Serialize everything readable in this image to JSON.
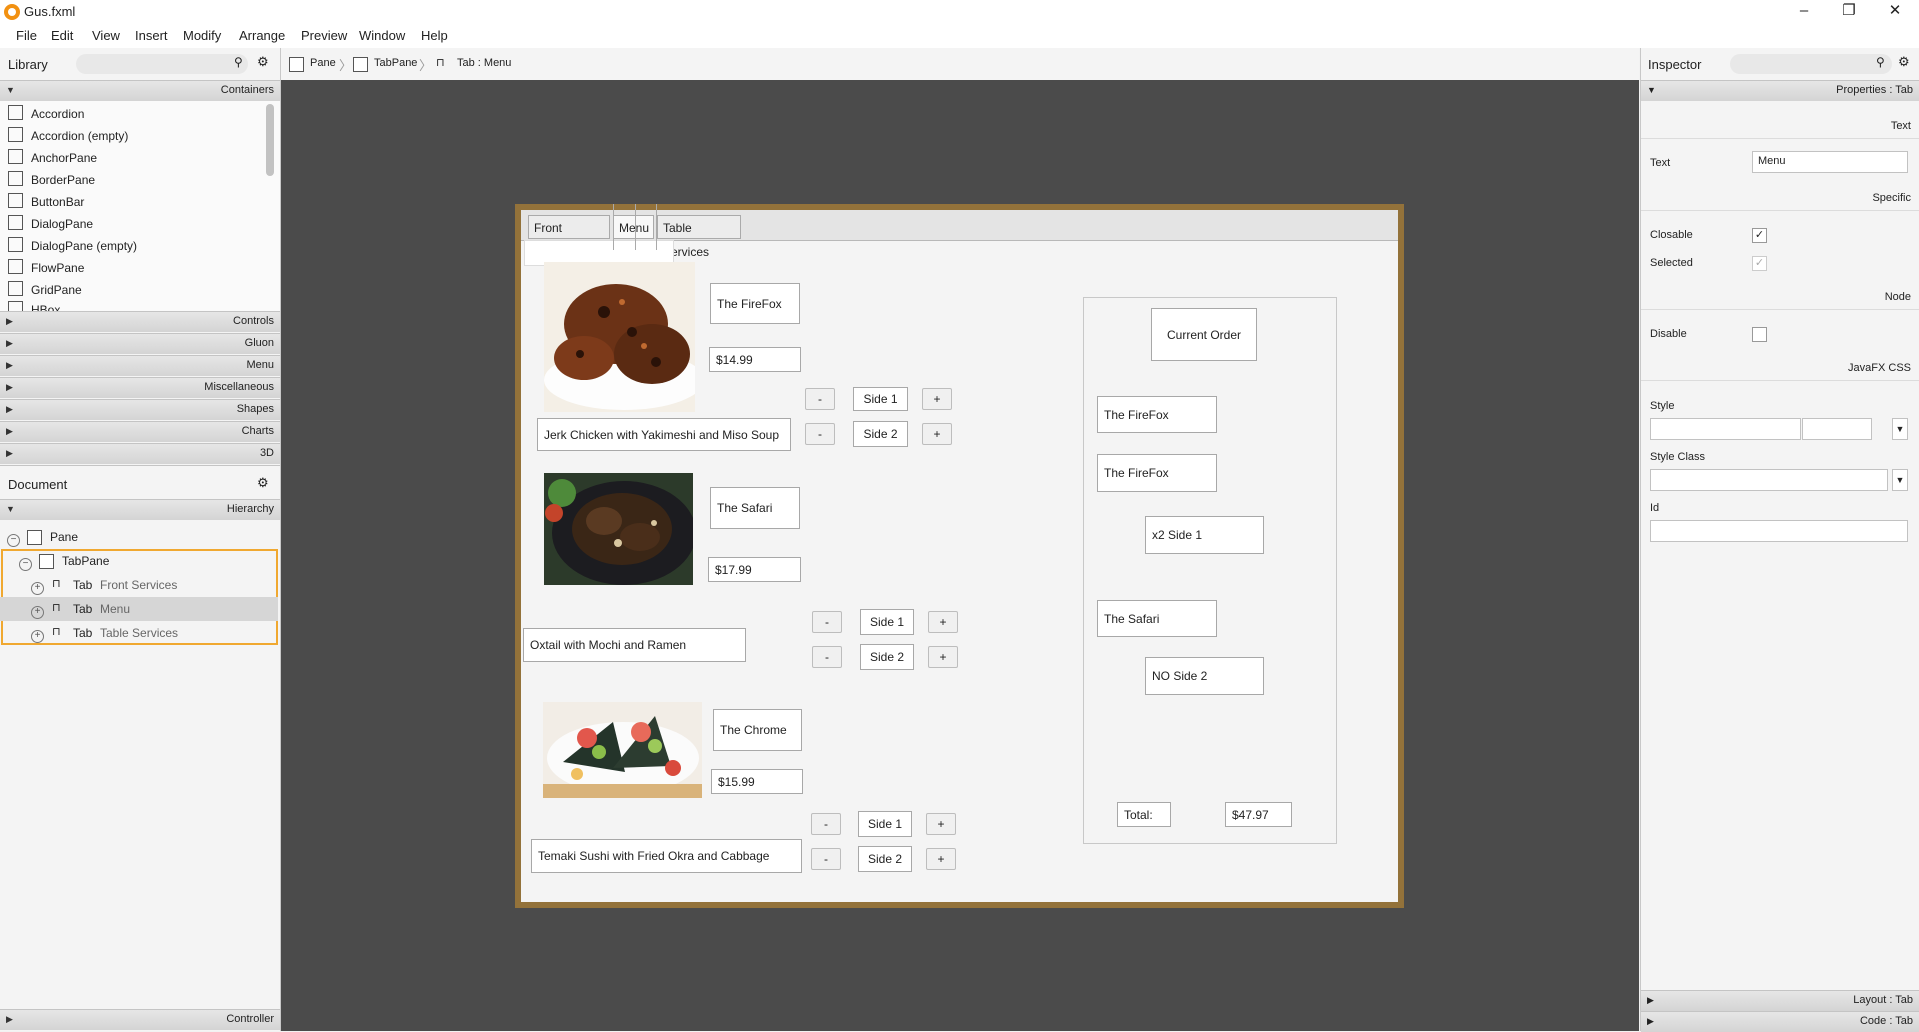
{
  "window": {
    "title": "Gus.fxml",
    "minimize": "–",
    "maximize": "❐",
    "close": "✕"
  },
  "menubar": [
    "File",
    "Edit",
    "View",
    "Insert",
    "Modify",
    "Arrange",
    "Preview",
    "Window",
    "Help"
  ],
  "library": {
    "title": "Library",
    "sections": {
      "containers": "Containers",
      "controls": "Controls",
      "gluon": "Gluon",
      "menu": "Menu",
      "misc": "Miscellaneous",
      "shapes": "Shapes",
      "charts": "Charts",
      "three_d": "3D"
    },
    "items": [
      "Accordion",
      "Accordion  (empty)",
      "AnchorPane",
      "BorderPane",
      "ButtonBar",
      "DialogPane",
      "DialogPane  (empty)",
      "FlowPane",
      "GridPane",
      "HBox"
    ]
  },
  "document": {
    "title": "Document",
    "hierarchy_label": "Hierarchy",
    "nodes": {
      "pane": "Pane",
      "tabpane": "TabPane",
      "tab1_type": "Tab",
      "tab1_name": "Front Services",
      "tab2_type": "Tab",
      "tab2_name": "Menu",
      "tab3_type": "Tab",
      "tab3_name": "Table Services"
    },
    "controller": "Controller"
  },
  "breadcrumb": {
    "pane": "Pane",
    "tabpane": "TabPane",
    "tab": "Tab : Menu"
  },
  "design": {
    "tabs": {
      "front": "Front Services",
      "menu": "Menu",
      "table": "Table Services"
    },
    "items": [
      {
        "name": "The FireFox",
        "price": "$14.99",
        "desc": "Jerk Chicken with Yakimeshi and Miso Soup"
      },
      {
        "name": "The Safari",
        "price": "$17.99",
        "desc": "Oxtail with Mochi and Ramen"
      },
      {
        "name": "The Chrome",
        "price": "$15.99",
        "desc": "Temaki Sushi with Fried Okra and Cabbage"
      }
    ],
    "buttons": {
      "minus": "-",
      "plus": "+",
      "side1": "Side 1",
      "side2": "Side 2"
    },
    "order": {
      "title": "Current Order",
      "line1": "The FireFox",
      "line2": "The FireFox",
      "line3": "x2 Side 1",
      "line4": "The Safari",
      "line5": "NO Side 2",
      "total_label": "Total:",
      "total_value": "$47.97"
    }
  },
  "inspector": {
    "title": "Inspector",
    "properties_header": "Properties : Tab",
    "text_section": "Text",
    "text_label": "Text",
    "text_value": "Menu",
    "specific_section": "Specific",
    "closable_label": "Closable",
    "selected_label": "Selected",
    "node_section": "Node",
    "disable_label": "Disable",
    "css_section": "JavaFX CSS",
    "style_label": "Style",
    "style_class_label": "Style Class",
    "id_label": "Id",
    "layout_header": "Layout : Tab",
    "code_header": "Code : Tab"
  }
}
